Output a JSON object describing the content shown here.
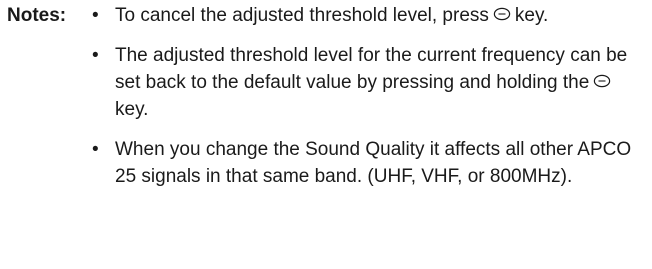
{
  "notes_label": "Notes:",
  "notes": [
    {
      "bullet": "•",
      "before_icon": "To cancel the adjusted threshold level, press",
      "icon": "select-key-icon",
      "after_icon": "key."
    },
    {
      "bullet": "•",
      "before_icon": "The adjusted threshold level for the current frequency can be set back to the default value by pressing and holding the",
      "icon": "select-key-icon",
      "after_icon": "key."
    },
    {
      "bullet": "•",
      "text": "When you change the Sound Quality it affects all other APCO 25 signals in that same band. (UHF, VHF, or 800MHz)."
    }
  ]
}
